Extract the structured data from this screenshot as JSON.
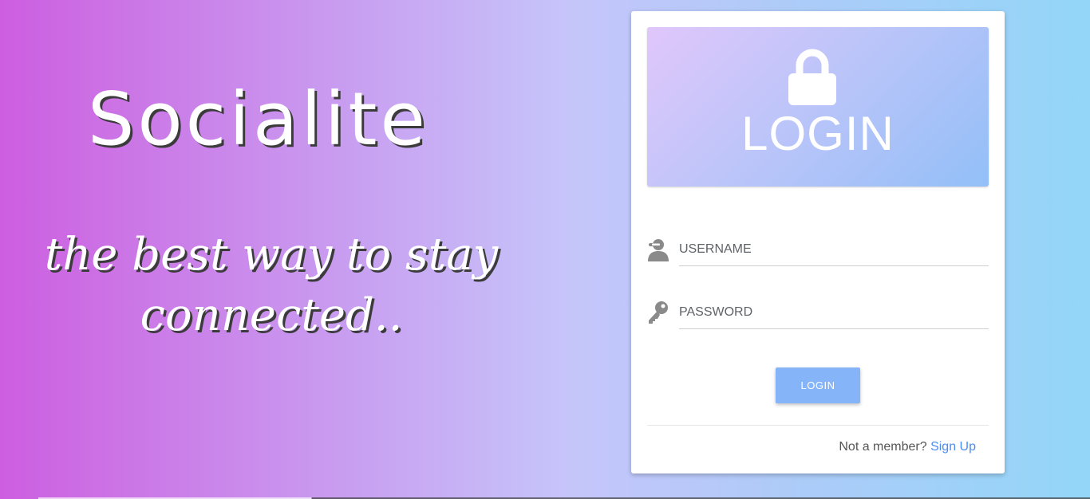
{
  "hero": {
    "title": "Socialite",
    "tagline": "the best way to stay connected.."
  },
  "login_card": {
    "header_icon": "lock-icon",
    "header_title": "LOGIN",
    "username": {
      "icon": "user-icon",
      "placeholder": "USERNAME",
      "value": ""
    },
    "password": {
      "icon": "key-icon",
      "placeholder": "PASSWORD",
      "value": ""
    },
    "submit_label": "LOGIN",
    "footer": {
      "prompt": "Not a member?",
      "link_label": "Sign Up"
    }
  },
  "colors": {
    "accent": "#85b4f9",
    "link": "#4a8df0"
  }
}
